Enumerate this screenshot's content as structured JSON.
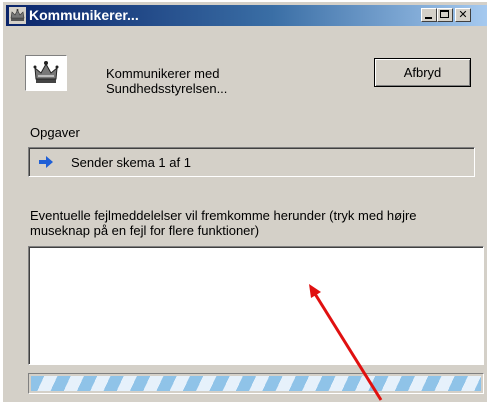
{
  "window": {
    "title": "Kommunikerer...",
    "status_line_1": "Kommunikerer med",
    "status_line_2": "Sundhedsstyrelsen...",
    "cancel_label": "Afbryd"
  },
  "tasks": {
    "label": "Opgaver",
    "current": "Sender skema 1 af 1"
  },
  "errors": {
    "info_text": "Eventuelle fejlmeddelelser vil fremkomme herunder (tryk med højre museknap på en fejl for flere funktioner)",
    "messages": []
  },
  "progress": {
    "fraction": 1.0,
    "style": "indeterminate-striped"
  },
  "icons": {
    "title": "crown-icon",
    "logo": "crown-logo-icon",
    "task": "arrow-right-icon"
  },
  "colors": {
    "titlebar_start": "#0a246a",
    "titlebar_end": "#a6caf0",
    "window_bg": "#d4d0c8",
    "arrow": "#1f5fd6",
    "annotation_arrow": "#e01010"
  }
}
